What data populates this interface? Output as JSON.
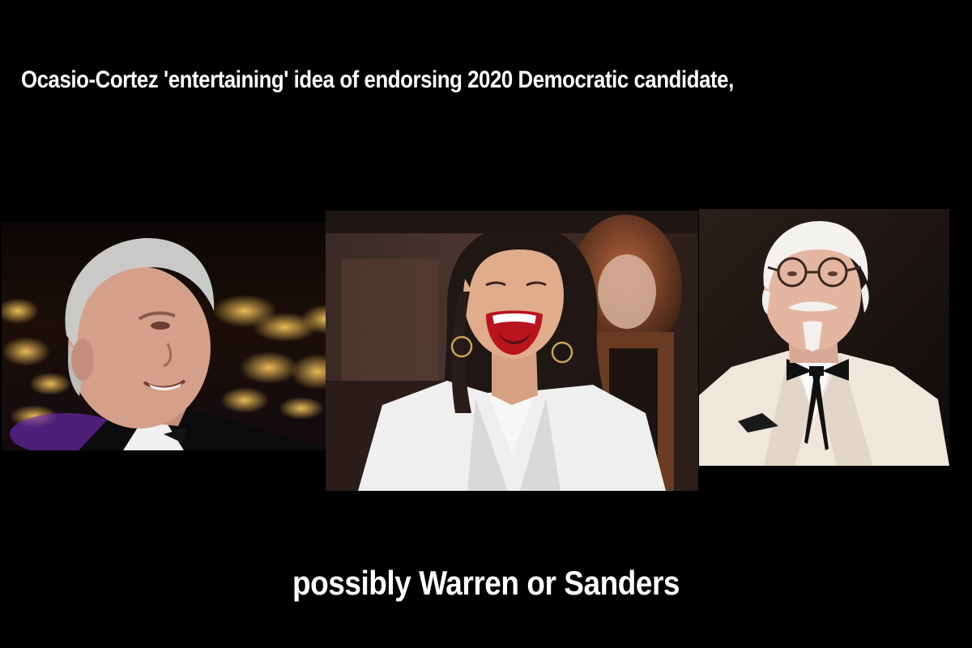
{
  "headline": {
    "top": "Ocasio-Cortez 'entertaining' idea of endorsing 2020 Democratic candidate,",
    "bottom": "possibly Warren or Sanders"
  },
  "photos": [
    {
      "name": "photo-older-man-tuxedo",
      "content": "smiling gray-haired man in a tuxedo against dark background with gold lights"
    },
    {
      "name": "photo-laughing-woman",
      "content": "laughing woman with long dark hair, red lipstick, hoop earrings and a white blazer"
    },
    {
      "name": "photo-white-suit-man",
      "content": "older man with white hair, glasses, goatee, white suit and black string tie"
    }
  ],
  "colors": {
    "background": "#000000",
    "text": "#ffffff"
  }
}
